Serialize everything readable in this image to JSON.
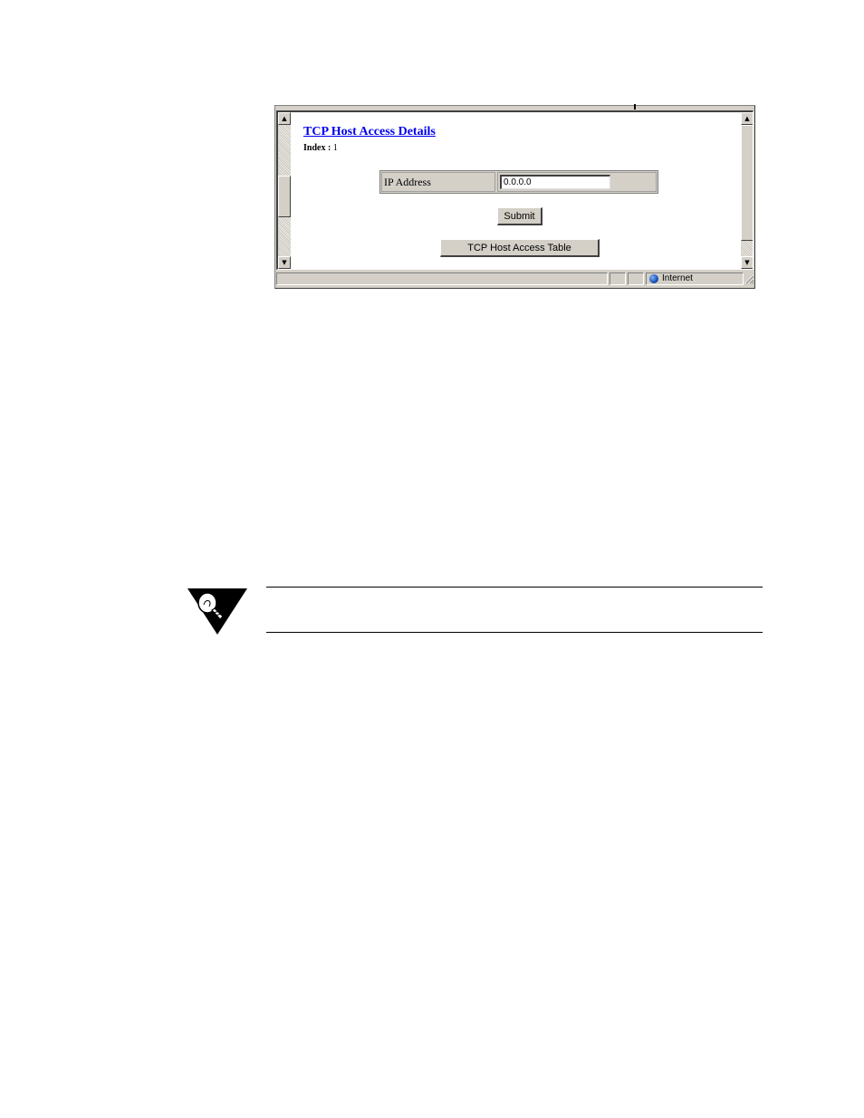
{
  "browser": {
    "page": {
      "title": "TCP Host Access Details",
      "index_label": "Index :",
      "index_value": "1",
      "form": {
        "ip_address_label": "IP Address",
        "ip_address_value": "0.0.0.0"
      },
      "submit_label": "Submit",
      "table_button_label": "TCP Host Access Table"
    },
    "status_bar": {
      "zone_label": "Internet",
      "zone_icon": "globe-icon"
    }
  },
  "note": {
    "icon": "lightbulb-note-icon"
  }
}
